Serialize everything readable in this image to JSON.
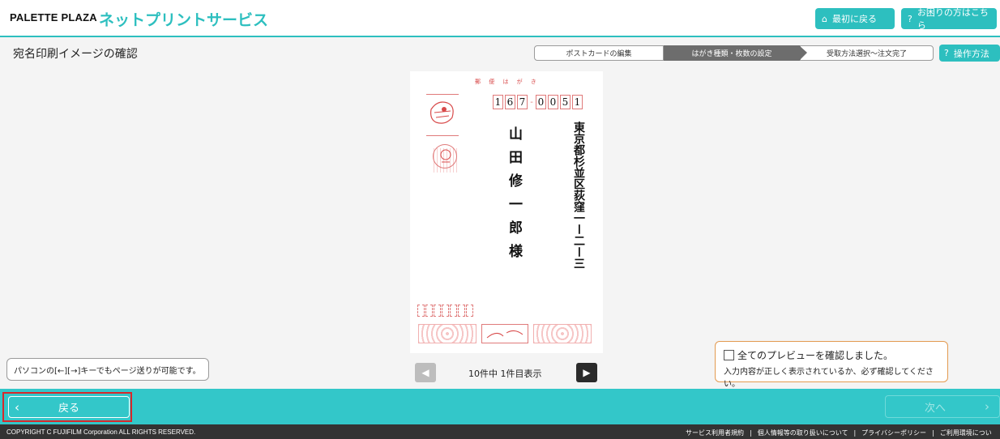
{
  "header": {
    "brand": "PALETTE PLAZA",
    "service": "ネットプリントサービス",
    "home_button": "最初に戻る",
    "help_button": "お困りの方はこちら"
  },
  "page": {
    "title": "宛名印刷イメージの確認",
    "steps": [
      "ポストカードの編集",
      "はがき種類・枚数の設定",
      "受取方法選択～注文完了"
    ],
    "ops_button": "操作方法"
  },
  "postcard": {
    "header_text": "郵 便 は が き",
    "zip": [
      "1",
      "6",
      "7",
      "-",
      "0",
      "0",
      "5",
      "1"
    ],
    "address": "東京都杉並区荻窪一ー二ー三",
    "name": "山田修一郎様"
  },
  "pager": {
    "text": "10件中 1件目表示"
  },
  "hint": "パソコンの[←][→]キーでもページ送りが可能です。",
  "confirm": {
    "label": "全てのプレビューを確認しました。",
    "note": "入力内容が正しく表示されているか、必ず確認してください。"
  },
  "footer": {
    "back": "戻る",
    "next": "次へ",
    "copyright": "COPYRIGHT C FUJIFILM Corporation ALL RIGHTS RESERVED.",
    "links": [
      "サービス利用者規約",
      "個人情報等の取り扱いについて",
      "プライバシーポリシー",
      "ご利用環境につい"
    ]
  },
  "colors": {
    "accent": "#33c7c9",
    "highlight": "#d8282b"
  },
  "icons": [
    "home-icon",
    "question-icon",
    "chevron-left-icon",
    "chevron-right-icon",
    "play-left-icon",
    "play-right-icon"
  ]
}
